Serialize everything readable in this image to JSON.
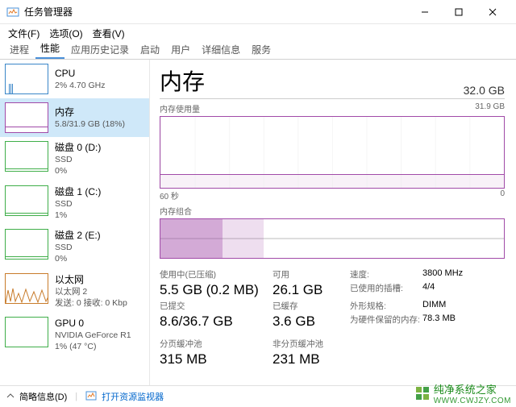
{
  "window": {
    "title": "任务管理器"
  },
  "menu": {
    "file": "文件(F)",
    "options": "选项(O)",
    "view": "查看(V)"
  },
  "tabs": [
    "进程",
    "性能",
    "应用历史记录",
    "启动",
    "用户",
    "详细信息",
    "服务"
  ],
  "active_tab": 1,
  "sidebar": {
    "items": [
      {
        "name": "CPU",
        "sub": "2%  4.70 GHz"
      },
      {
        "name": "内存",
        "sub": "5.8/31.9 GB (18%)"
      },
      {
        "name": "磁盘 0 (D:)",
        "sub": "SSD",
        "sub2": "0%"
      },
      {
        "name": "磁盘 1 (C:)",
        "sub": "SSD",
        "sub2": "1%"
      },
      {
        "name": "磁盘 2 (E:)",
        "sub": "SSD",
        "sub2": "0%"
      },
      {
        "name": "以太网",
        "sub": "以太网 2",
        "sub2": "发送: 0 接收: 0 Kbp"
      },
      {
        "name": "GPU 0",
        "sub": "NVIDIA GeForce R1",
        "sub2": "1% (47 °C)"
      }
    ]
  },
  "main": {
    "title": "内存",
    "capacity": "32.0 GB",
    "usage_label": "内存使用量",
    "usage_max": "31.9 GB",
    "axis_left": "60 秒",
    "axis_right": "0",
    "compo_label": "内存组合",
    "stats": {
      "inuse_label": "使用中(已压缩)",
      "inuse": "5.5 GB (0.2 MB)",
      "avail_label": "可用",
      "avail": "26.1 GB",
      "commit_label": "已提交",
      "commit": "8.6/36.7 GB",
      "cached_label": "已缓存",
      "cached": "3.6 GB",
      "paged_label": "分页缓冲池",
      "paged": "315 MB",
      "nonpaged_label": "非分页缓冲池",
      "nonpaged": "231 MB",
      "speed_label": "速度:",
      "speed": "3800 MHz",
      "slots_label": "已使用的插槽:",
      "slots": "4/4",
      "form_label": "外形规格:",
      "form": "DIMM",
      "reserved_label": "为硬件保留的内存:",
      "reserved": "78.3 MB"
    }
  },
  "footer": {
    "less": "简略信息(D)",
    "open_rm": "打开资源监视器"
  },
  "watermark": {
    "brand": "纯净系统之家",
    "url": "WWW.CWJZY.COM"
  }
}
